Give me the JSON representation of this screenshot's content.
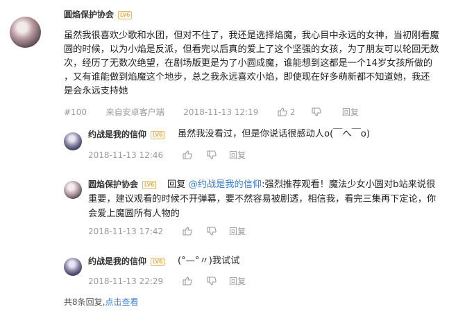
{
  "main_comment": {
    "author": "圆焰保护协会",
    "level": "LV6",
    "text_lines": [
      "虽然我很喜欢少歌和水团，但对不住了，我还是选择焰魔，我心目中永远的女神，当初刚看魔",
      "圆的时候，以为小焰是反派，但看完以后真的爱上了这个坚强的女孩，为了朋友可以轮回无数",
      "次，经历了无数次绝望，在剧场版更是为了小圆成魔，谁能想到这都是一个14岁女孩所做的",
      "，又有谁能做到焰魔这个地步，总之我永远喜欢小焰，即使现在好多萌新都不知道她，我还",
      "是会永远支持她"
    ],
    "floor": "#100",
    "source": "来自安卓客户端",
    "timestamp": "2018-11-13 12:19",
    "like_count": "2",
    "reply_label": "回复"
  },
  "replies": [
    {
      "author": "约战是我的信仰",
      "level": "LV6",
      "text": "虽然我没看过，但是你说话很感动人o(￣へ￣o)",
      "timestamp": "2018-11-13 12:46",
      "reply_label": "回复"
    },
    {
      "author": "圆焰保护协会",
      "level": "LV6",
      "prefix": "回复",
      "mention": "@约战是我的信仰",
      "text_lines": [
        ":强烈推荐观看！魔法少女小圆对b站来说很",
        "重要，建议观看的时候不开弹幕，要不然容易被剧透，相信我，看完三集再下定论，你",
        "会爱上魔圆所有人物的"
      ],
      "timestamp": "2018-11-13 17:42",
      "reply_label": "回复"
    },
    {
      "author": "约战是我的信仰",
      "level": "LV6",
      "text": "(°—°〃)我试试",
      "timestamp": "2018-11-13 22:29",
      "reply_label": "回复"
    }
  ],
  "footer": {
    "summary": "共8条回复,",
    "expand_link": "点击查看"
  },
  "colors": {
    "link": "#3b7ed0",
    "meta": "#9a9a9a",
    "level_badge": "#d4962a"
  }
}
